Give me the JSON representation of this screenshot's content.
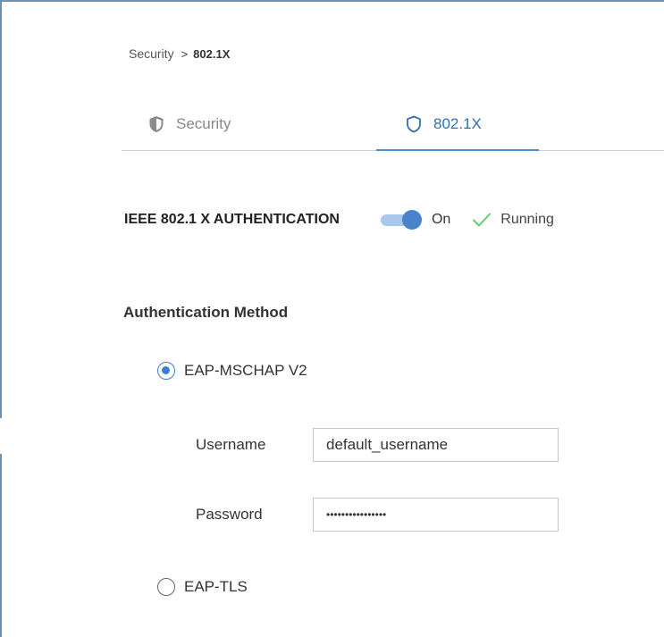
{
  "breadcrumb": {
    "parent": "Security",
    "separator": ">",
    "current": "802.1X"
  },
  "tabs": [
    {
      "label": "Security",
      "icon": "shield-filled-icon",
      "active": false
    },
    {
      "label": "802.1X",
      "icon": "shield-outline-icon",
      "active": true
    }
  ],
  "auth": {
    "title": "IEEE 802.1 X AUTHENTICATION",
    "toggle_state": "On",
    "toggle_on": true,
    "status_icon": "check-icon",
    "status": "Running"
  },
  "method": {
    "title": "Authentication Method",
    "options": [
      {
        "label": "EAP-MSCHAP V2",
        "selected": true
      },
      {
        "label": "EAP-TLS",
        "selected": false
      }
    ]
  },
  "credentials": {
    "username_label": "Username",
    "username_value": "default_username",
    "password_label": "Password",
    "password_value": "••••••••••••••••"
  },
  "colors": {
    "accent": "#4a83cc",
    "tab_active": "#2f6fb5",
    "toggle_track": "#a9c8ec",
    "check": "#5fcf6b"
  }
}
